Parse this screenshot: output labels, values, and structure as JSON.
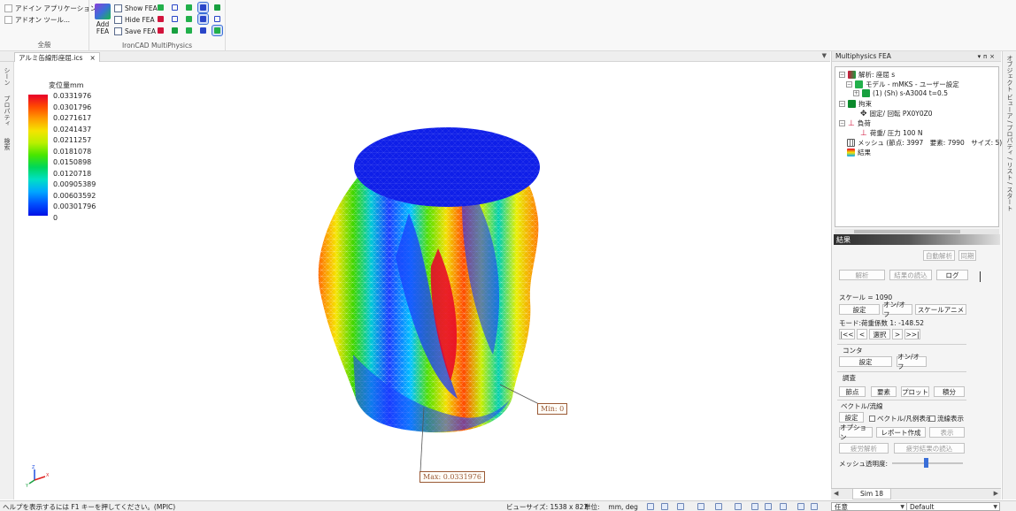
{
  "ribbon": {
    "addin_app_label": "アドイン アプリケーション...",
    "addon_tool_label": "アドオン ツール...",
    "general_group": "全般",
    "add_fea_label": "Add FEA",
    "show_fea_label": "Show FEA",
    "hide_fea_label": "Hide FEA",
    "save_fea_label": "Save FEA",
    "multiphysics_group": "IronCAD MultiPhysics"
  },
  "document": {
    "tab_label": "アルミ缶線形座屈.ics",
    "tab_close": "×"
  },
  "left_strip": {
    "scene": "シーン",
    "properties": "プロパティ",
    "search": "検索"
  },
  "legend": {
    "title": "変位量mm",
    "values": [
      "0.0331976",
      "0.0301796",
      "0.0271617",
      "0.0241437",
      "0.0211257",
      "0.0181078",
      "0.0150898",
      "0.0120718",
      "0.00905389",
      "0.00603592",
      "0.00301796",
      "0"
    ]
  },
  "callouts": {
    "min_label": "Min: 0",
    "max_label": "Max: 0.0331976"
  },
  "axes": {
    "x": "X",
    "y": "Y",
    "z": "Z"
  },
  "panel": {
    "title": "Multiphysics FEA",
    "tree": [
      {
        "label": "解析: 座屈 s"
      },
      {
        "label": "モデル - mMKS - ユーザー設定"
      },
      {
        "label": "(1) (Sh) s-A3004 t=0.5"
      },
      {
        "label": "拘束"
      },
      {
        "label": "固定/ 回転 PX0Y0Z0"
      },
      {
        "label": "負荷"
      },
      {
        "label": "荷重/ 圧力 100 N"
      },
      {
        "label": "メッシュ (節点: 3997　要素: 7990　サイズ: 5) mm"
      },
      {
        "label": "結果"
      }
    ],
    "results_header": "結果",
    "auto_analysis": "自動解析",
    "sync": "同期",
    "analyze": "解析",
    "load_results": "結果の読込",
    "log": "ログ",
    "scale_label": "スケール = 1090",
    "settings": "設定",
    "on_off": "オン/オフ",
    "scale_anim": "スケールアニメ",
    "mode_label": "モード:荷重係数 1: -148.52",
    "first": "|<<",
    "prev": "<",
    "select": "選択",
    "next": ">",
    "last": ">>|",
    "contour_label": "コンタ",
    "probe_label": "調査",
    "node": "節点",
    "element": "要素",
    "plot": "プロット",
    "integral": "積分",
    "vector_label": "ベクトル/流線",
    "vector_legend": "ベクトル/凡例表示",
    "streamline": "流線表示",
    "option": "オプション",
    "report": "レポート作成",
    "display": "表示",
    "fatigue": "疲労解析",
    "fatigue_load": "疲労結果の読込",
    "mesh_transparency": "メッシュ透明度:",
    "sim_tab": "Sim 18"
  },
  "right_strip": {
    "label": "オブジェクト ビューア / プロパティ / リスト / スタート"
  },
  "status": {
    "help": "ヘルプを表示するには F1 キーを押してください。(MPIC)",
    "view_size": "ビューサイズ: 1538 x 827",
    "units": "単位:　 mm, deg",
    "mode_combo": "任意",
    "style_combo": "Default"
  }
}
